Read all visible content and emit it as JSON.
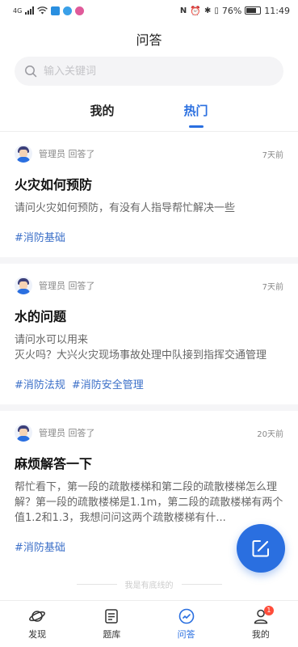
{
  "status_bar": {
    "network": "4G",
    "battery_level": "76%",
    "time": "11:49"
  },
  "header": {
    "title": "问答"
  },
  "search": {
    "placeholder": "输入关键词"
  },
  "tabs": [
    {
      "label": "我的",
      "active": false
    },
    {
      "label": "热门",
      "active": true
    }
  ],
  "questions": [
    {
      "author": "管理员 回答了",
      "time": "7天前",
      "title": "火灾如何预防",
      "body": "请问火灾如何预防，有没有人指导帮忙解决一些",
      "tags": [
        "#消防基础"
      ]
    },
    {
      "author": "管理员 回答了",
      "time": "7天前",
      "title": "水的问题",
      "body": "请问水可以用来\n灭火吗？大兴火灾现场事故处理中队接到指挥交通管理",
      "tags": [
        "#消防法规",
        "#消防安全管理"
      ]
    },
    {
      "author": "管理员 回答了",
      "time": "20天前",
      "title": "麻烦解答一下",
      "body": "帮忙看下，第一段的疏散楼梯和第二段的疏散楼梯怎么理解？第一段的疏散楼梯是1.1m，第二段的疏散楼梯有两个值1.2和1.3，我想问问这两个疏散楼梯有什...",
      "tags": [
        "#消防基础"
      ]
    }
  ],
  "list_end_text": "我是有底线的",
  "tabbar": [
    {
      "label": "发现",
      "icon": "planet-icon"
    },
    {
      "label": "题库",
      "icon": "question-bank-icon"
    },
    {
      "label": "问答",
      "icon": "qa-icon",
      "active": true
    },
    {
      "label": "我的",
      "icon": "user-icon",
      "badge": "1"
    }
  ],
  "colors": {
    "accent": "#2a6fe0",
    "tag": "#3b6fc8",
    "badge": "#ff4d3a"
  }
}
